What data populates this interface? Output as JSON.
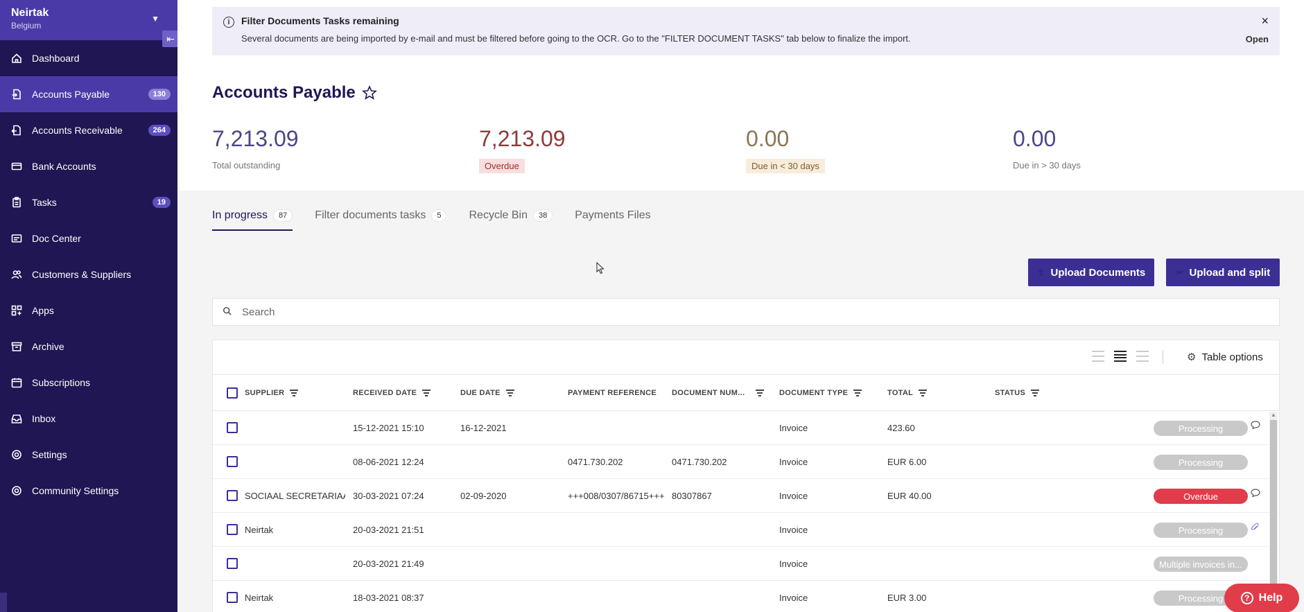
{
  "org": {
    "name": "Neirtak",
    "country": "Belgium"
  },
  "sidebar": {
    "items": [
      {
        "label": "Dashboard",
        "icon": "home-icon",
        "badge": ""
      },
      {
        "label": "Accounts Payable",
        "icon": "document-in-icon",
        "badge": "130",
        "active": true
      },
      {
        "label": "Accounts Receivable",
        "icon": "document-out-icon",
        "badge": "264"
      },
      {
        "label": "Bank Accounts",
        "icon": "card-icon",
        "badge": ""
      },
      {
        "label": "Tasks",
        "icon": "clipboard-icon",
        "badge": "19"
      },
      {
        "label": "Doc Center",
        "icon": "folder-icon",
        "badge": ""
      },
      {
        "label": "Customers & Suppliers",
        "icon": "users-icon",
        "badge": ""
      },
      {
        "label": "Apps",
        "icon": "grid-icon",
        "badge": ""
      },
      {
        "label": "Archive",
        "icon": "archive-icon",
        "badge": ""
      },
      {
        "label": "Subscriptions",
        "icon": "calendar-icon",
        "badge": ""
      },
      {
        "label": "Inbox",
        "icon": "inbox-icon",
        "badge": ""
      },
      {
        "label": "Settings",
        "icon": "gear-icon",
        "badge": ""
      },
      {
        "label": "Community Settings",
        "icon": "gear-icon",
        "badge": ""
      }
    ]
  },
  "alert": {
    "title": "Filter Documents Tasks remaining",
    "text": "Several documents are being imported by e-mail and must be filtered before going to the OCR. Go to the \"FILTER DOCUMENT TASKS\" tab below to finalize the import.",
    "close": "×",
    "open": "Open"
  },
  "page": {
    "title": "Accounts Payable"
  },
  "stats": {
    "total": {
      "value": "7,213.09",
      "label": "Total outstanding"
    },
    "overdue": {
      "value": "7,213.09",
      "label": "Overdue"
    },
    "due_lt30": {
      "value": "0.00",
      "label": "Due in < 30 days"
    },
    "due_gt30": {
      "value": "0.00",
      "label": "Due in > 30 days"
    }
  },
  "tabs": [
    {
      "label": "In progress",
      "count": "87"
    },
    {
      "label": "Filter documents tasks",
      "count": "5"
    },
    {
      "label": "Recycle Bin",
      "count": "38"
    },
    {
      "label": "Payments Files",
      "count": ""
    }
  ],
  "buttons": {
    "upload": "Upload Documents",
    "split": "Upload and split"
  },
  "search": {
    "placeholder": "Search"
  },
  "table": {
    "options_label": "Table options",
    "columns": [
      "SUPPLIER",
      "RECEIVED DATE",
      "DUE DATE",
      "PAYMENT REFERENCE",
      "DOCUMENT NUM...",
      "DOCUMENT TYPE",
      "TOTAL",
      "STATUS"
    ],
    "rows": [
      {
        "supplier": "",
        "received": "15-12-2021 15:10",
        "due": "16-12-2021",
        "payref": "",
        "docnum": "",
        "type": "Invoice",
        "total": "423.60",
        "status": "Processing",
        "status_kind": "processing",
        "icon": "comment-icon"
      },
      {
        "supplier": "",
        "received": "08-06-2021 12:24",
        "due": "",
        "payref": "0471.730.202",
        "docnum": "0471.730.202",
        "type": "Invoice",
        "total": "EUR 6.00",
        "status": "Processing",
        "status_kind": "processing",
        "icon": ""
      },
      {
        "supplier": "SOCIAAL SECRETARIAAT V...",
        "received": "30-03-2021 07:24",
        "due": "02-09-2020",
        "payref": "+++008/0307/86715+++",
        "docnum": "80307867",
        "type": "Invoice",
        "total": "EUR 40.00",
        "status": "Overdue",
        "status_kind": "overdue",
        "icon": "comment-icon"
      },
      {
        "supplier": "Neirtak",
        "received": "20-03-2021 21:51",
        "due": "",
        "payref": "",
        "docnum": "",
        "type": "Invoice",
        "total": "",
        "status": "Processing",
        "status_kind": "processing",
        "icon": "paperclip-icon"
      },
      {
        "supplier": "",
        "received": "20-03-2021 21:49",
        "due": "",
        "payref": "",
        "docnum": "",
        "type": "Invoice",
        "total": "",
        "status": "Multiple invoices in...",
        "status_kind": "processing",
        "icon": ""
      },
      {
        "supplier": "Neirtak",
        "received": "18-03-2021 08:37",
        "due": "",
        "payref": "",
        "docnum": "",
        "type": "Invoice",
        "total": "EUR 3.00",
        "status": "Processing",
        "status_kind": "processing",
        "icon": ""
      }
    ]
  },
  "help": {
    "label": "Help"
  }
}
